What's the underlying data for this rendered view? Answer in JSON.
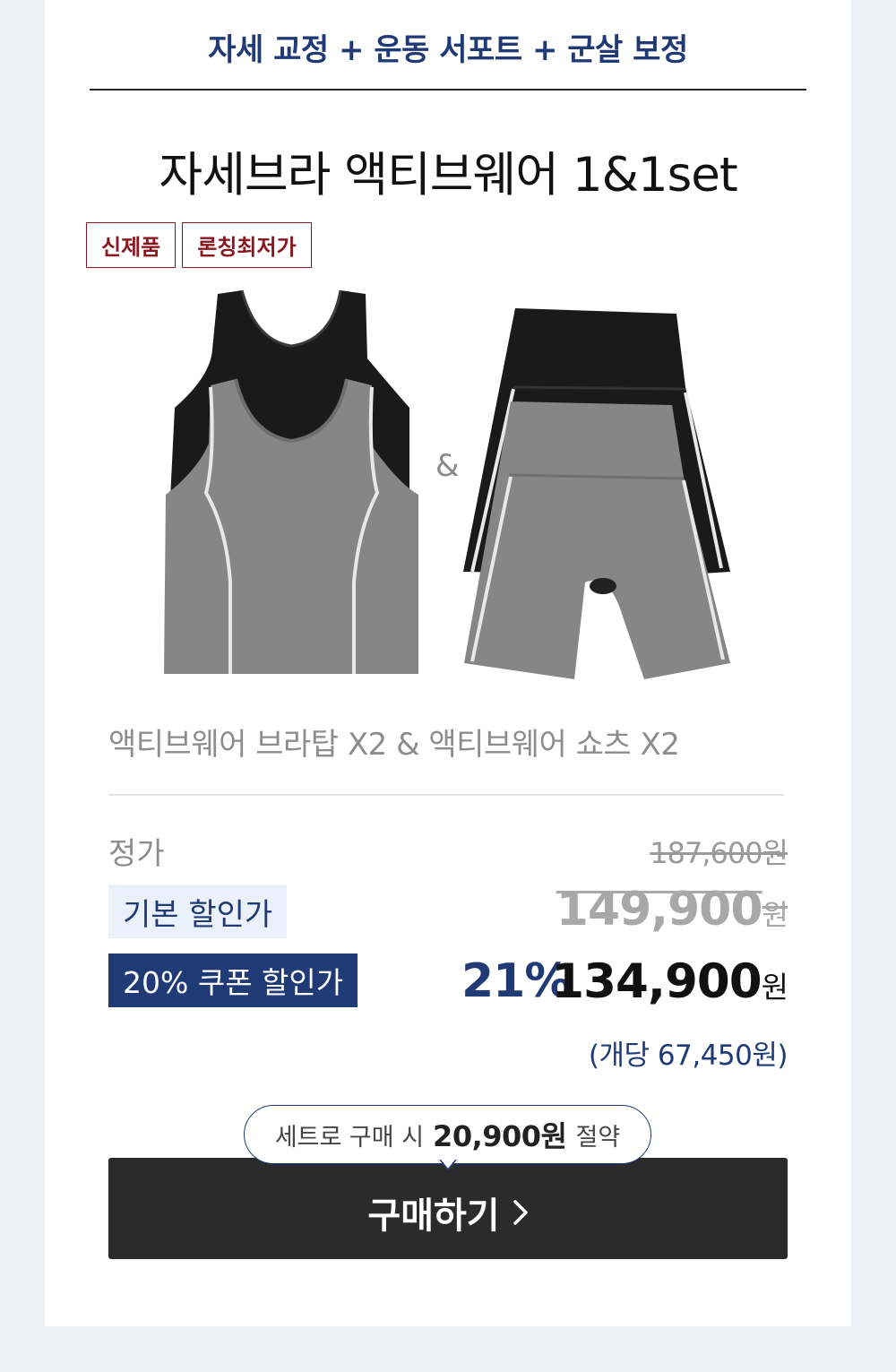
{
  "header": {
    "tagline": "자세 교정 + 운동 서포트 + 군살 보정"
  },
  "product": {
    "title": "자세브라 액티브웨어 1&1set",
    "badges": [
      "신제품",
      "론칭최저가"
    ],
    "image_separator": "&",
    "image_items": [
      "active-bra-top-icon",
      "active-shorts-icon"
    ],
    "subtitle": "액티브웨어 브라탑 X2 & 액티브웨어 쇼츠 X2"
  },
  "pricing": {
    "regular_label": "정가",
    "regular_price": "187,600원",
    "basic_label": "기본 할인가",
    "basic_price": "149,900",
    "basic_unit": "원",
    "coupon_label": "20% 쿠폰 할인가",
    "discount_pct": "21%",
    "final_price": "134,900",
    "final_unit": "원",
    "per_unit": "(개당 67,450원)"
  },
  "promo": {
    "prefix": "세트로 구매 시",
    "amount": "20,900원",
    "suffix": "절약"
  },
  "cta": {
    "label": "구매하기",
    "icon": "chevron-right-icon"
  },
  "colors": {
    "navy": "#1f3a75",
    "badge_red": "#8a1620",
    "button": "#2b2b2b",
    "background": "#eef2f8"
  }
}
